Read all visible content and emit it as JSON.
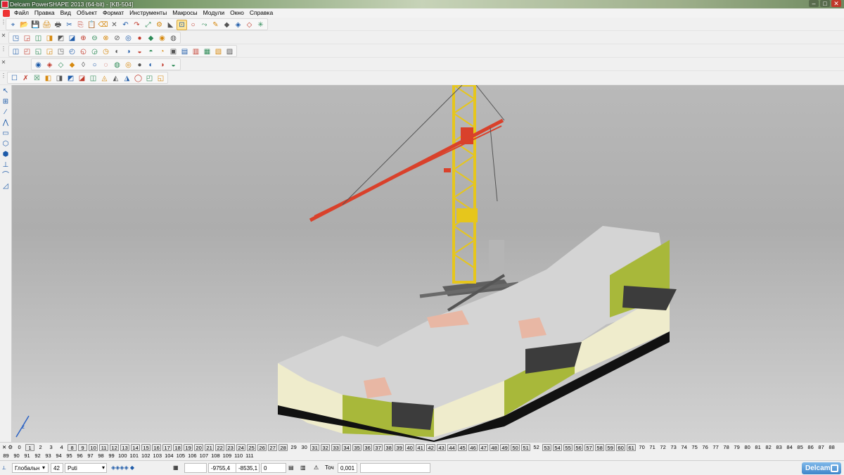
{
  "window": {
    "title": "Delcam PowerSHAPE 2013 (64-bit) - [KB-504]",
    "controls": [
      "–",
      "□",
      "✕"
    ]
  },
  "menu": [
    "Файл",
    "Правка",
    "Вид",
    "Объект",
    "Формат",
    "Инструменты",
    "Макросы",
    "Модули",
    "Окно",
    "Справка"
  ],
  "toolbars": {
    "row1": [
      "⌖",
      "📂",
      "💾",
      "🖨",
      "🖶",
      "✂",
      "⎘",
      "📋",
      "⌫",
      "✕",
      "↶",
      "↷",
      "⤢",
      "⚙",
      "◣",
      "⊡",
      "○",
      "⤳",
      "✎",
      "◆",
      "◈",
      "◇",
      "✳"
    ],
    "row2": [
      "◳",
      "◲",
      "◫",
      "◨",
      "◩",
      "◪",
      "⊕",
      "⊖",
      "⊗",
      "⊘",
      "◎",
      "●",
      "◆",
      "◉",
      "◍"
    ],
    "row3": [
      "◫",
      "◰",
      "◱",
      "◲",
      "◳",
      "◴",
      "◵",
      "◶",
      "◷",
      "◐",
      "◑",
      "◒",
      "◓",
      "◔",
      "▣",
      "▤",
      "▥",
      "▦",
      "▧",
      "▨"
    ],
    "row4": [
      "◉",
      "◈",
      "◇",
      "◆",
      "◊",
      "○",
      "◌",
      "◍",
      "◎",
      "●",
      "◐",
      "◑",
      "◒"
    ],
    "row5": [
      "☐",
      "✗",
      "☒",
      "◧",
      "◨",
      "◩",
      "◪",
      "◫",
      "◬",
      "◭",
      "◮",
      "◯",
      "◰",
      "◱"
    ]
  },
  "left_tools": [
    "↖",
    "⊞",
    "∕",
    "⋀",
    "▭",
    "⬡",
    "⬢",
    "⊥",
    "⌒",
    "◿"
  ],
  "levels": {
    "row1": [
      "0",
      "1",
      "2",
      "3",
      "4",
      "8",
      "9",
      "10",
      "11",
      "12",
      "13",
      "14",
      "15",
      "16",
      "17",
      "18",
      "19",
      "20",
      "21",
      "22",
      "23",
      "24",
      "25",
      "26",
      "27",
      "28",
      "29",
      "30",
      "31",
      "32",
      "33",
      "34",
      "35",
      "36",
      "37",
      "38",
      "39",
      "40",
      "41",
      "42",
      "43",
      "44",
      "45",
      "46",
      "47",
      "48",
      "49",
      "50",
      "51",
      "52",
      "53",
      "54",
      "55",
      "56",
      "57",
      "58",
      "59",
      "60",
      "61",
      "70",
      "71",
      "72",
      "73",
      "74",
      "75",
      "76",
      "77",
      "78",
      "79",
      "80",
      "81",
      "82",
      "83",
      "84",
      "85",
      "86",
      "87",
      "88"
    ],
    "row2": [
      "89",
      "90",
      "91",
      "92",
      "93",
      "94",
      "95",
      "96",
      "97",
      "98",
      "99",
      "100",
      "101",
      "102",
      "103",
      "104",
      "105",
      "106",
      "107",
      "108",
      "109",
      "110",
      "111"
    ],
    "active_row1": [
      "1",
      "8",
      "9",
      "10",
      "11",
      "12",
      "13",
      "14",
      "15",
      "16",
      "17",
      "18",
      "19",
      "20",
      "21",
      "22",
      "23",
      "24",
      "25",
      "26",
      "27",
      "28",
      "31",
      "32",
      "33",
      "34",
      "35",
      "36",
      "37",
      "38",
      "39",
      "40",
      "41",
      "42",
      "43",
      "44",
      "45",
      "46",
      "47",
      "48",
      "49",
      "50",
      "51",
      "53",
      "54",
      "55",
      "56",
      "57",
      "58",
      "59",
      "60",
      "61"
    ]
  },
  "status": {
    "workplane": "Глобальн",
    "level_num": "42",
    "level_name": "Puti",
    "x": "-9755,4",
    "y": "-8535,1",
    "z": "0",
    "tol_label": "Точ",
    "tol": "0,001",
    "brand": "Delcam"
  },
  "colors": {
    "crane_mast": "#e6c61c",
    "crane_jib": "#d9412b",
    "roof": "#d4d4d4",
    "facade_green": "#a8b83a",
    "facade_cream": "#efeccc"
  }
}
